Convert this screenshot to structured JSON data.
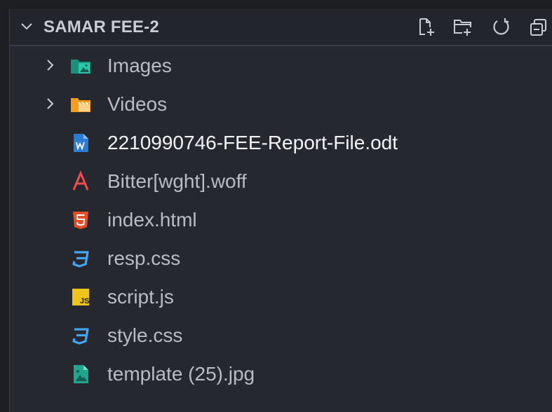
{
  "explorer": {
    "title": "SAMAR FEE-2",
    "actions": [
      {
        "name": "new-file-icon",
        "tooltip": "New File..."
      },
      {
        "name": "new-folder-icon",
        "tooltip": "New Folder..."
      },
      {
        "name": "refresh-icon",
        "tooltip": "Refresh Explorer"
      },
      {
        "name": "collapse-all-icon",
        "tooltip": "Collapse Folders in Explorer"
      }
    ]
  },
  "tree": [
    {
      "label": "Images",
      "type": "folder",
      "icon": "images-folder-icon",
      "expanded": false
    },
    {
      "label": "Videos",
      "type": "folder",
      "icon": "videos-folder-icon",
      "expanded": false
    },
    {
      "label": "2210990746-FEE-Report-File.odt",
      "type": "file",
      "icon": "word-document-icon"
    },
    {
      "label": "Bitter[wght].woff",
      "type": "file",
      "icon": "font-file-icon"
    },
    {
      "label": "index.html",
      "type": "file",
      "icon": "html5-icon"
    },
    {
      "label": "resp.css",
      "type": "file",
      "icon": "css3-icon"
    },
    {
      "label": "script.js",
      "type": "file",
      "icon": "javascript-icon"
    },
    {
      "label": "style.css",
      "type": "file",
      "icon": "css3-icon"
    },
    {
      "label": "template (25).jpg",
      "type": "file",
      "icon": "image-file-icon"
    }
  ],
  "colors": {
    "background": "#262830",
    "text": "#b9bcc4",
    "highlight_text": "#f2f3f5",
    "folder_images": "#20a58e",
    "folder_videos": "#f59c1c",
    "html": "#e44d26",
    "css": "#42a5f5",
    "js": "#f0c419"
  }
}
